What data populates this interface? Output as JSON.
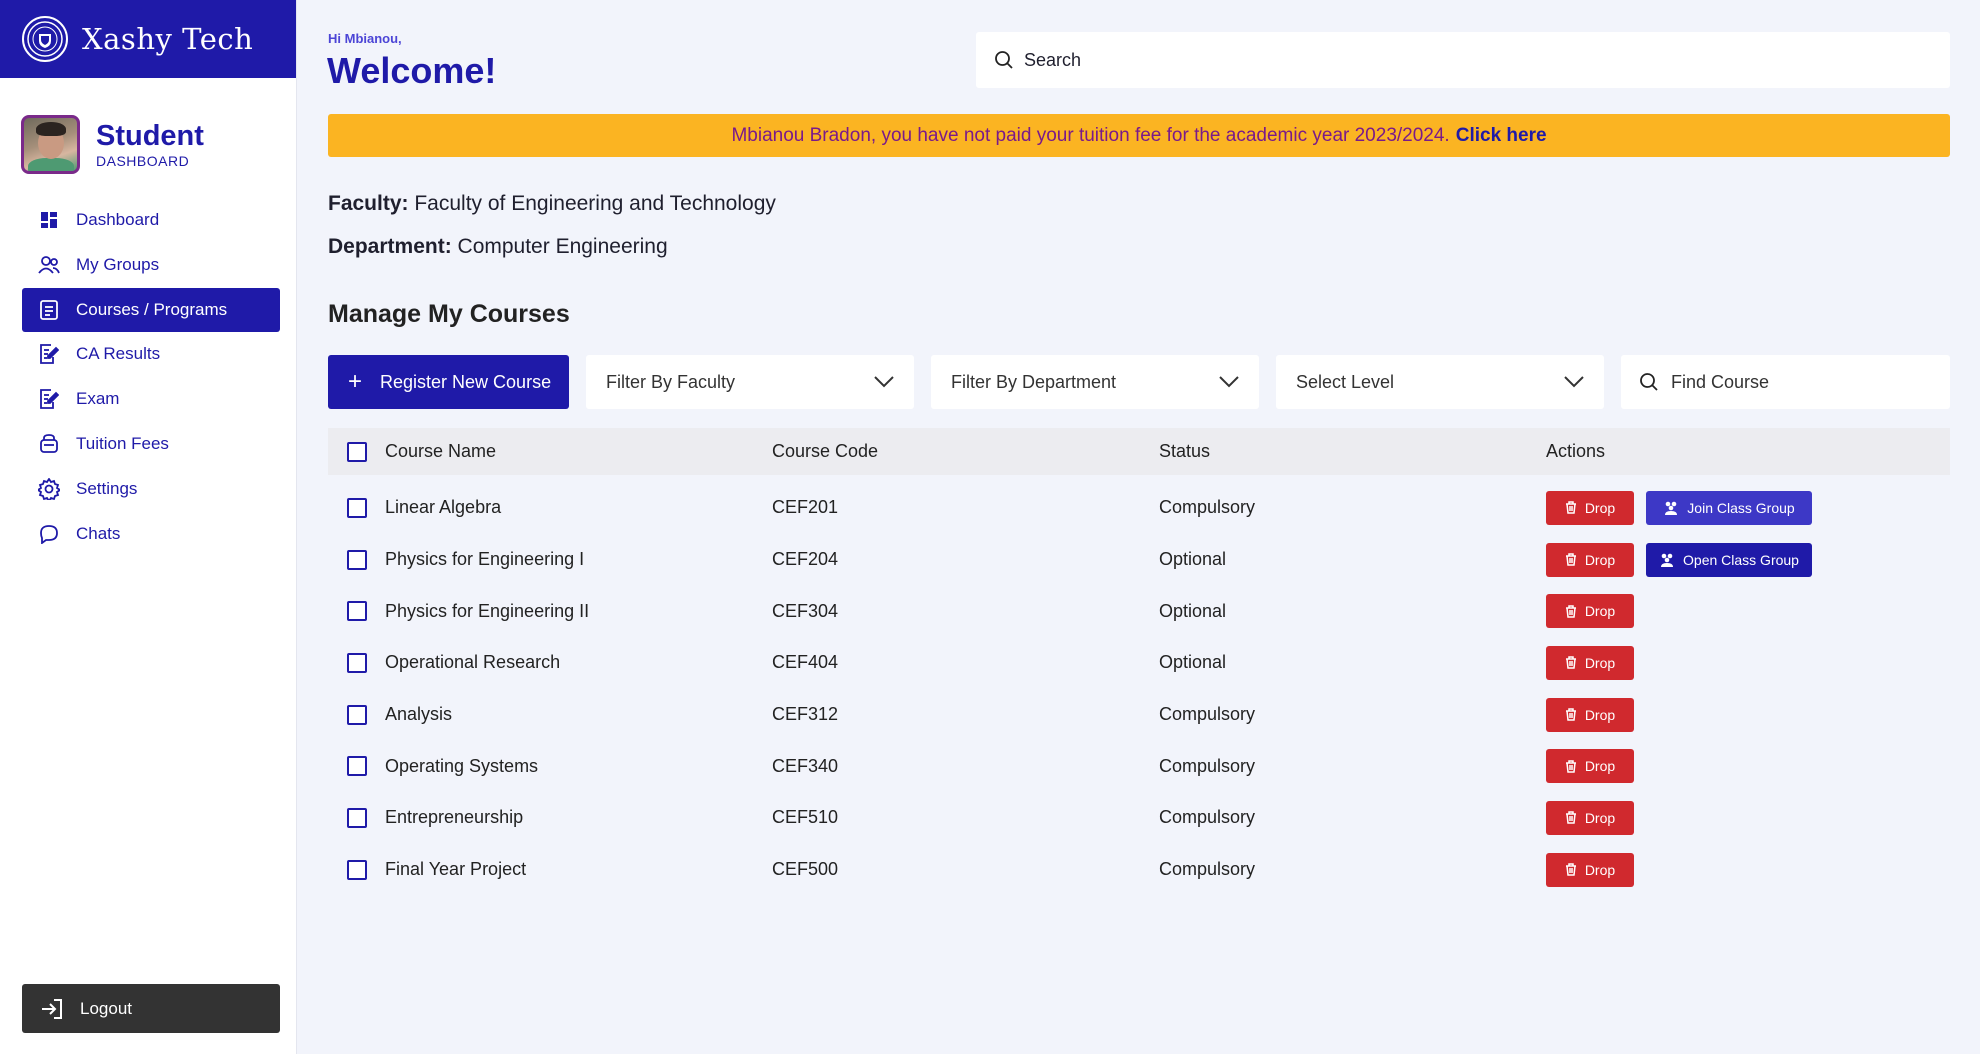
{
  "brand": {
    "name": "Xashy Tech"
  },
  "profile": {
    "role": "Student",
    "subtitle": "DASHBOARD"
  },
  "nav": {
    "items": [
      {
        "label": "Dashboard",
        "icon": "dashboard-icon"
      },
      {
        "label": "My Groups",
        "icon": "users-icon"
      },
      {
        "label": "Courses / Programs",
        "icon": "document-icon",
        "active": true
      },
      {
        "label": "CA Results",
        "icon": "edit-document-icon"
      },
      {
        "label": "Exam",
        "icon": "edit-document-icon"
      },
      {
        "label": "Tuition Fees",
        "icon": "wallet-icon"
      },
      {
        "label": "Settings",
        "icon": "gear-icon"
      },
      {
        "label": "Chats",
        "icon": "chat-icon"
      }
    ],
    "logout_label": "Logout"
  },
  "header": {
    "greeting": "Hi Mbianou,",
    "title": "Welcome!",
    "search_placeholder": "Search"
  },
  "banner": {
    "message": "Mbianou Bradon, you have not paid your tuition fee for the academic year 2023/2024.",
    "link": "Click here"
  },
  "info": {
    "faculty_label": "Faculty:",
    "faculty_value": "Faculty of Engineering and Technology",
    "department_label": "Department:",
    "department_value": "Computer Engineering"
  },
  "courses": {
    "title": "Manage My Courses",
    "register_label": "Register New Course",
    "filter_faculty": "Filter By Faculty",
    "filter_department": "Filter By Department",
    "select_level": "Select Level",
    "find_placeholder": "Find Course",
    "columns": [
      "Course Name",
      "Course Code",
      "Status",
      "Actions"
    ],
    "drop_label": "Drop",
    "rows": [
      {
        "name": "Linear Algebra",
        "code": "CEF201",
        "status": "Compulsory",
        "group_action": "Join Class Group"
      },
      {
        "name": "Physics for Engineering I",
        "code": "CEF204",
        "status": "Optional",
        "group_action": "Open Class Group"
      },
      {
        "name": "Physics for Engineering II",
        "code": "CEF304",
        "status": "Optional",
        "group_action": null
      },
      {
        "name": "Operational Research",
        "code": "CEF404",
        "status": "Optional",
        "group_action": null
      },
      {
        "name": "Analysis",
        "code": "CEF312",
        "status": "Compulsory",
        "group_action": null
      },
      {
        "name": "Operating Systems",
        "code": "CEF340",
        "status": "Compulsory",
        "group_action": null
      },
      {
        "name": "Entrepreneurship",
        "code": "CEF510",
        "status": "Compulsory",
        "group_action": null
      },
      {
        "name": "Final Year Project",
        "code": "CEF500",
        "status": "Compulsory",
        "group_action": null
      }
    ]
  },
  "colors": {
    "primary": "#1f1aa8",
    "banner": "#fbb422",
    "danger": "#d0292e",
    "background": "#f2f4fb"
  }
}
